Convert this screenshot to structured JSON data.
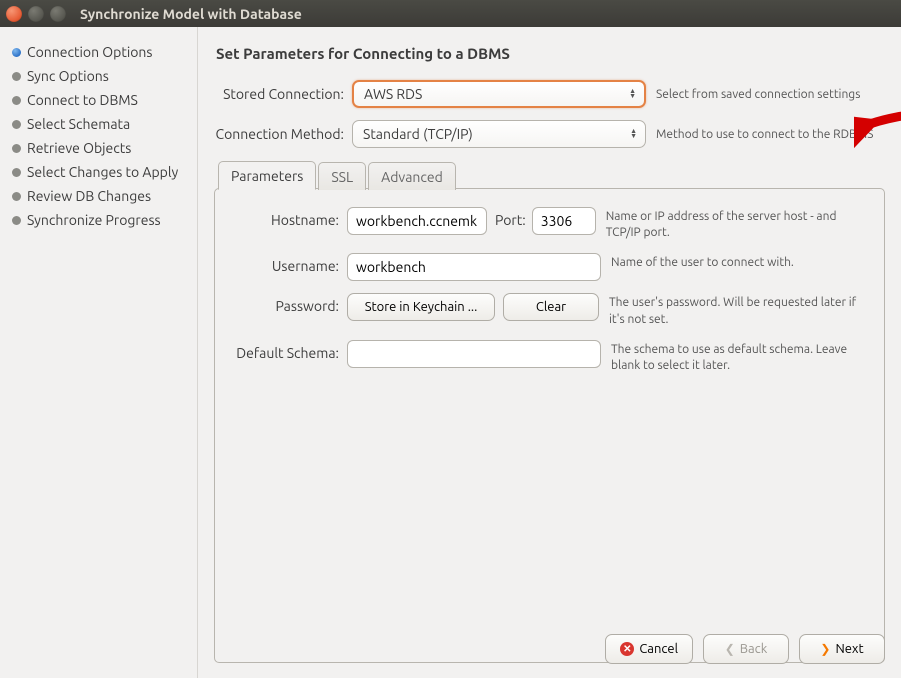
{
  "window": {
    "title": "Synchronize Model with Database"
  },
  "sidebar": {
    "items": [
      {
        "label": "Connection Options",
        "active": true
      },
      {
        "label": "Sync Options",
        "active": false
      },
      {
        "label": "Connect to DBMS",
        "active": false
      },
      {
        "label": "Select Schemata",
        "active": false
      },
      {
        "label": "Retrieve Objects",
        "active": false
      },
      {
        "label": "Select Changes to Apply",
        "active": false
      },
      {
        "label": "Review DB Changes",
        "active": false
      },
      {
        "label": "Synchronize Progress",
        "active": false
      }
    ]
  },
  "heading": "Set Parameters for Connecting to a DBMS",
  "stored_connection": {
    "label": "Stored Connection:",
    "value": "AWS RDS",
    "hint": "Select from saved connection settings"
  },
  "connection_method": {
    "label": "Connection Method:",
    "value": "Standard (TCP/IP)",
    "hint": "Method to use to connect to the RDBMS"
  },
  "tabs": [
    {
      "label": "Parameters",
      "active": true
    },
    {
      "label": "SSL",
      "active": false
    },
    {
      "label": "Advanced",
      "active": false
    }
  ],
  "params": {
    "hostname": {
      "label": "Hostname:",
      "value": "workbench.ccnemkb",
      "port_label": "Port:",
      "port_value": "3306",
      "hint": "Name or IP address of the server host - and TCP/IP port."
    },
    "username": {
      "label": "Username:",
      "value": "workbench",
      "hint": "Name of the user to connect with."
    },
    "password": {
      "label": "Password:",
      "store_label": "Store in Keychain ...",
      "clear_label": "Clear",
      "hint": "The user's password. Will be requested later if it's not set."
    },
    "schema": {
      "label": "Default Schema:",
      "value": "",
      "hint": "The schema to use as default schema. Leave blank to select it later."
    }
  },
  "footer": {
    "cancel": "Cancel",
    "back": "Back",
    "next": "Next"
  }
}
